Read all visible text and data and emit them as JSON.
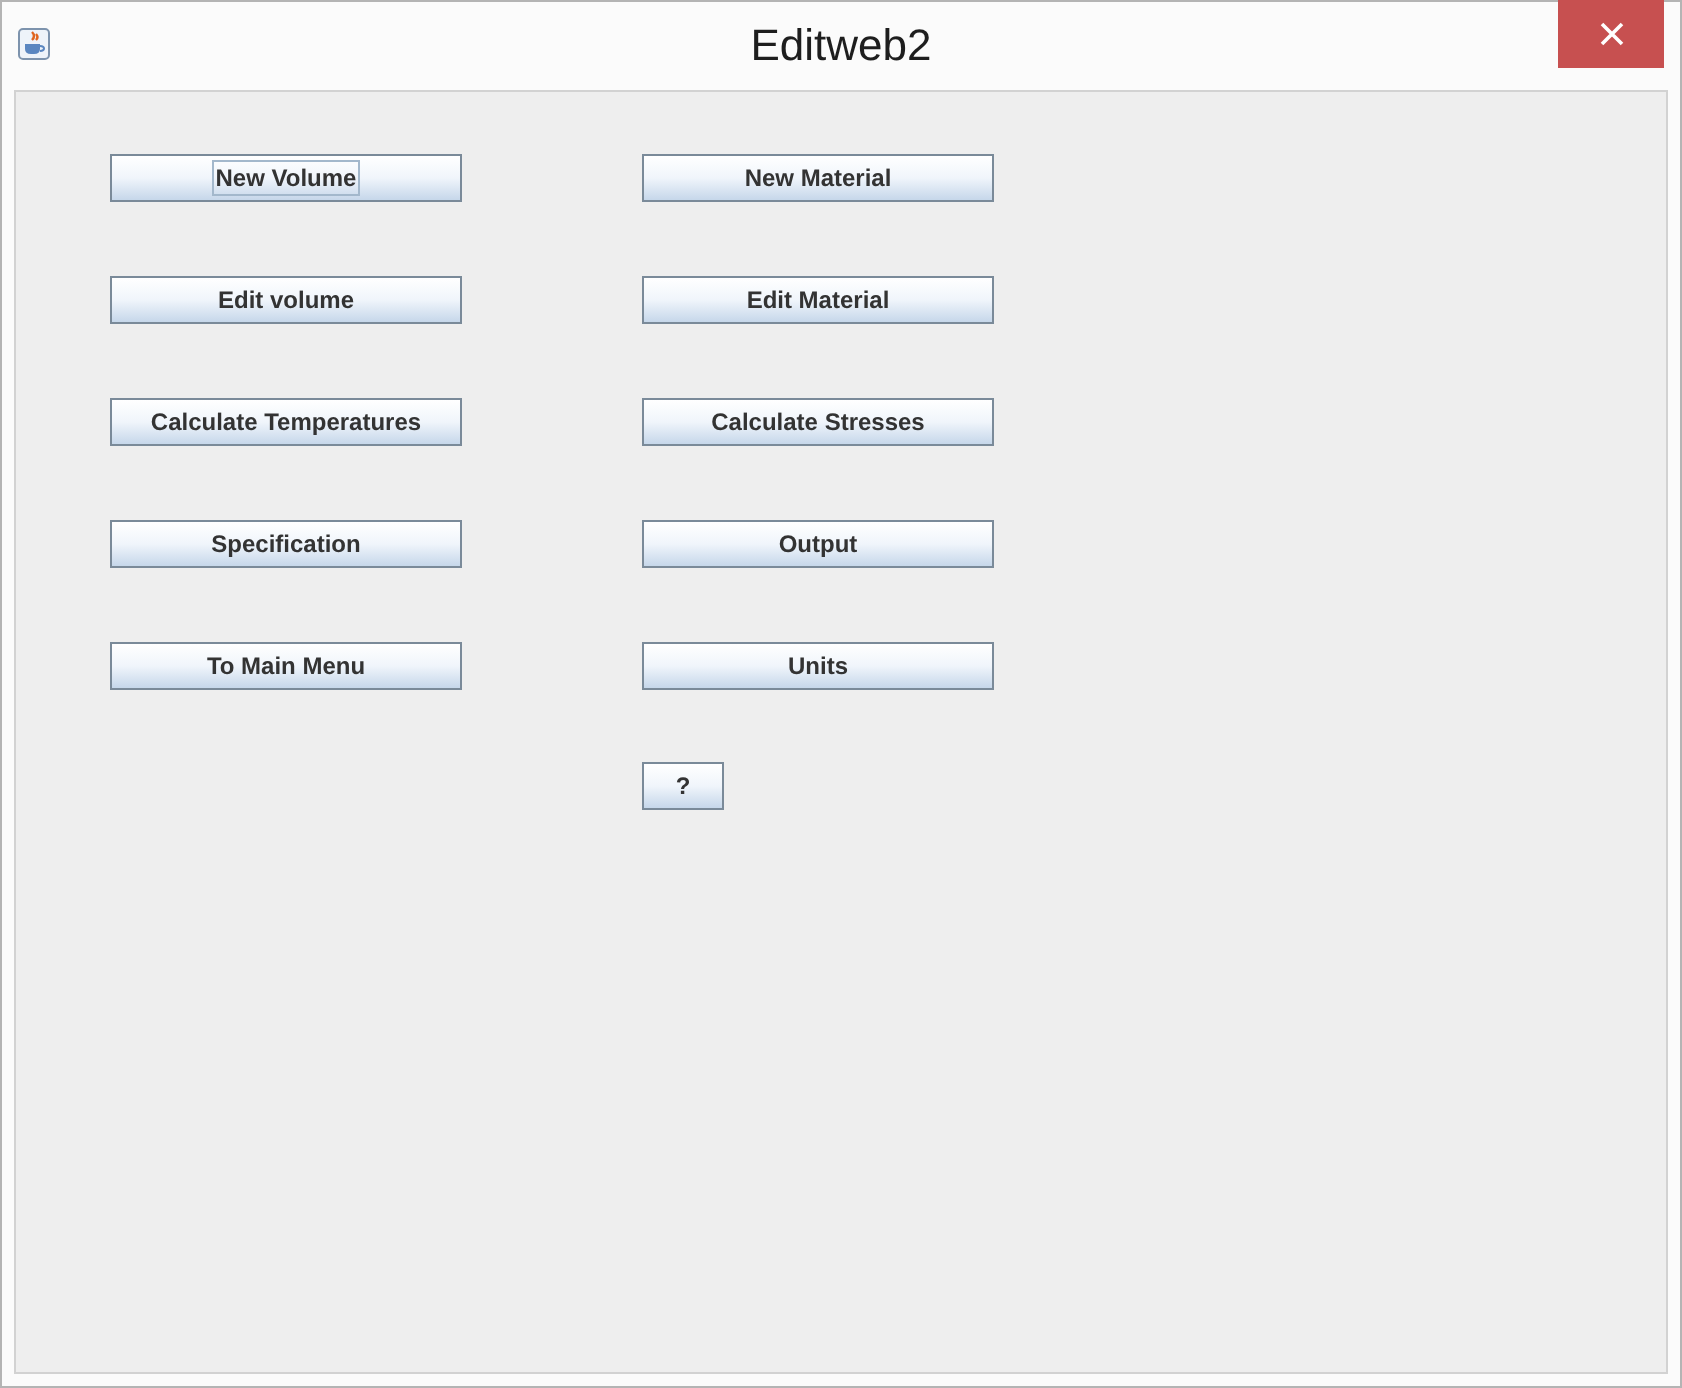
{
  "window": {
    "title": "Editweb2"
  },
  "left_buttons": [
    {
      "label": "New Volume",
      "focused": true
    },
    {
      "label": "Edit volume",
      "focused": false
    },
    {
      "label": "Calculate Temperatures",
      "focused": false
    },
    {
      "label": "Specification",
      "focused": false
    },
    {
      "label": "To Main Menu",
      "focused": false
    }
  ],
  "right_buttons": [
    {
      "label": "New Material",
      "focused": false
    },
    {
      "label": "Edit Material",
      "focused": false
    },
    {
      "label": "Calculate Stresses",
      "focused": false
    },
    {
      "label": "Output",
      "focused": false
    },
    {
      "label": "Units",
      "focused": false
    }
  ],
  "help_button": {
    "label": "?",
    "focused": false
  }
}
